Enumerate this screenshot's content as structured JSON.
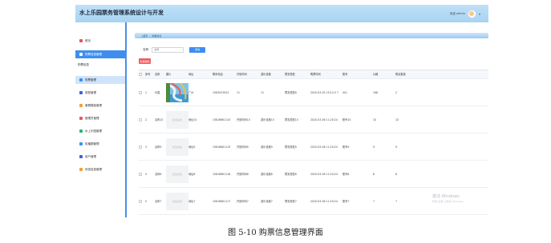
{
  "app": {
    "title": "水上乐园票务管理系统设计与开发",
    "user_text": "欢迎 admin"
  },
  "sidebar": {
    "section_label": "购票信息",
    "items": [
      {
        "label": "首页",
        "icon": "home-icon",
        "color": "#e8574a"
      },
      {
        "label": "购票信息管理",
        "icon": "list-icon",
        "color": "#2bb673",
        "active": true
      },
      {
        "label": "购票管理",
        "icon": "ticket-icon",
        "color": "#3d8ef0",
        "sub_active": true
      },
      {
        "label": "类型管理",
        "icon": "category-icon",
        "color": "#3d5fe0"
      },
      {
        "label": "套餐模板管理",
        "icon": "package-icon",
        "color": "#f0a030"
      },
      {
        "label": "管理员管理",
        "icon": "admin-icon",
        "color": "#e85a5a"
      },
      {
        "label": "水上乐园管理",
        "icon": "park-icon",
        "color": "#2bb673"
      },
      {
        "label": "轮播图管理",
        "icon": "carousel-icon",
        "color": "#3d8ef0"
      },
      {
        "label": "用户管理",
        "icon": "user-icon",
        "color": "#3d5fe0"
      },
      {
        "label": "系统信息管理",
        "icon": "system-icon",
        "color": "#f0a030"
      }
    ]
  },
  "breadcrumb": [
    "△首页",
    "/",
    "购票信息"
  ],
  "search": {
    "label": "名称:",
    "placeholder": "名称",
    "button": "查询"
  },
  "delete_button": "批量删除",
  "table": {
    "columns": [
      "序号",
      "名称",
      "图片",
      "地址",
      "联系电话",
      "开放时间",
      "游乐设施",
      "票务类型",
      "购票时间",
      "账号",
      "价格",
      "购买数量"
    ],
    "rows": [
      {
        "index": "1",
        "name": "乐园",
        "image": "park-photo",
        "address": "广州",
        "phone": "1563023923",
        "open": "11",
        "facility": "11",
        "type": "票务类型8",
        "time": "2020-03-05 15:12:3 7",
        "account": "001",
        "price": "198",
        "qty": "2"
      },
      {
        "index": "2",
        "name": "名称10",
        "image": "placeholder",
        "address": "地址10",
        "phone": "15816661110",
        "open": "开放时间10",
        "facility": "游乐设施10",
        "type": "票务类型10",
        "time": "2020-03-06 11:20:24",
        "account": "账号10",
        "price": "10",
        "qty": "10"
      },
      {
        "index": "3",
        "name": "名称9",
        "image": "placeholder",
        "address": "地址9",
        "phone": "15816661119",
        "open": "开放时间9",
        "facility": "游乐设施9",
        "type": "票务类型9",
        "time": "2020-03-06 11:20:24",
        "account": "账号9",
        "price": "9",
        "qty": "9"
      },
      {
        "index": "4",
        "name": "名称8",
        "image": "placeholder",
        "address": "地址8",
        "phone": "15816661118",
        "open": "开放时间8",
        "facility": "游乐设施8",
        "type": "票务类型8",
        "time": "2020-03-06 11:20:24",
        "account": "账号8",
        "price": "8",
        "qty": "8"
      },
      {
        "index": "5",
        "name": "名称7",
        "image": "placeholder",
        "address": "地址7",
        "phone": "15816661117",
        "open": "开放时间7",
        "facility": "游乐设施7",
        "type": "票务类型7",
        "time": "2020-03-06 11:20:24",
        "account": "账号7",
        "price": "7",
        "qty": "7"
      }
    ],
    "placeholder_image_text": "加载失败"
  },
  "watermark": {
    "line1": "激活 Windows",
    "line2": "转到\"设置\"以激活 Windows。"
  },
  "caption": "图 5-10 购票信息管理界面"
}
